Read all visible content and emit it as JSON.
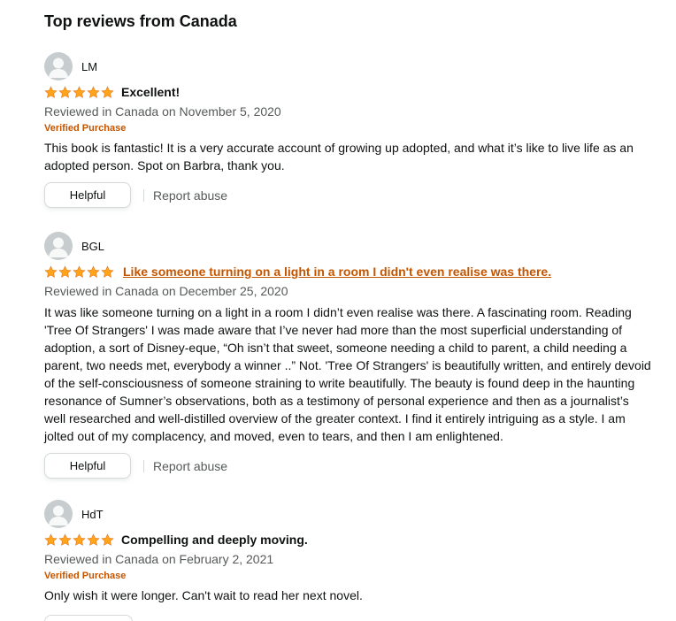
{
  "section": {
    "title": "Top reviews from Canada"
  },
  "colors": {
    "star": "#ffa41c",
    "star_stroke": "#de7921",
    "verified": "#c45500",
    "link": "#c45500",
    "meta": "#565959"
  },
  "reviews": [
    {
      "author": "LM",
      "rating": 5,
      "title": "Excellent!",
      "date": "Reviewed in Canada on November 5, 2020",
      "verified": "Verified Purchase",
      "body": "This book is fantastic! It is a very accurate account of growing up adopted, and what it’s like to live life as an adopted person. Spot on Barbra, thank you.",
      "helpful_label": "Helpful",
      "report_label": "Report abuse"
    },
    {
      "author": "BGL",
      "rating": 5,
      "title": "Like someone turning on a light in a room I didn't even realise was there.",
      "date": "Reviewed in Canada on December 25, 2020",
      "body": "It was like someone turning on a light in a room I didn’t even realise was there. A fascinating room. Reading 'Tree Of Strangers' I was made aware that I’ve never had more than the most superficial understanding of adoption, a sort of Disney-eque, “Oh isn’t that sweet, someone needing a child to parent, a child needing a parent, two needs met, everybody a winner ..” Not. 'Tree Of Strangers' is beautifully written, and entirely devoid of the self-consciousness of someone straining to write beautifully. The beauty is found deep in the haunting resonance of Sumner’s observations, both as a testimony of personal experience and then as a journalist’s well researched and well-distilled overview of the greater context. I find it entirely intriguing as a style. I am jolted out of my complacency, and moved, even to tears, and then I am enlightened.",
      "helpful_label": "Helpful",
      "report_label": "Report abuse"
    },
    {
      "author": "HdT",
      "rating": 5,
      "title": "Compelling and deeply moving.",
      "date": "Reviewed in Canada on February 2, 2021",
      "verified": "Verified Purchase",
      "body": "Only wish it were longer. Can't wait to read her next novel."
    }
  ]
}
